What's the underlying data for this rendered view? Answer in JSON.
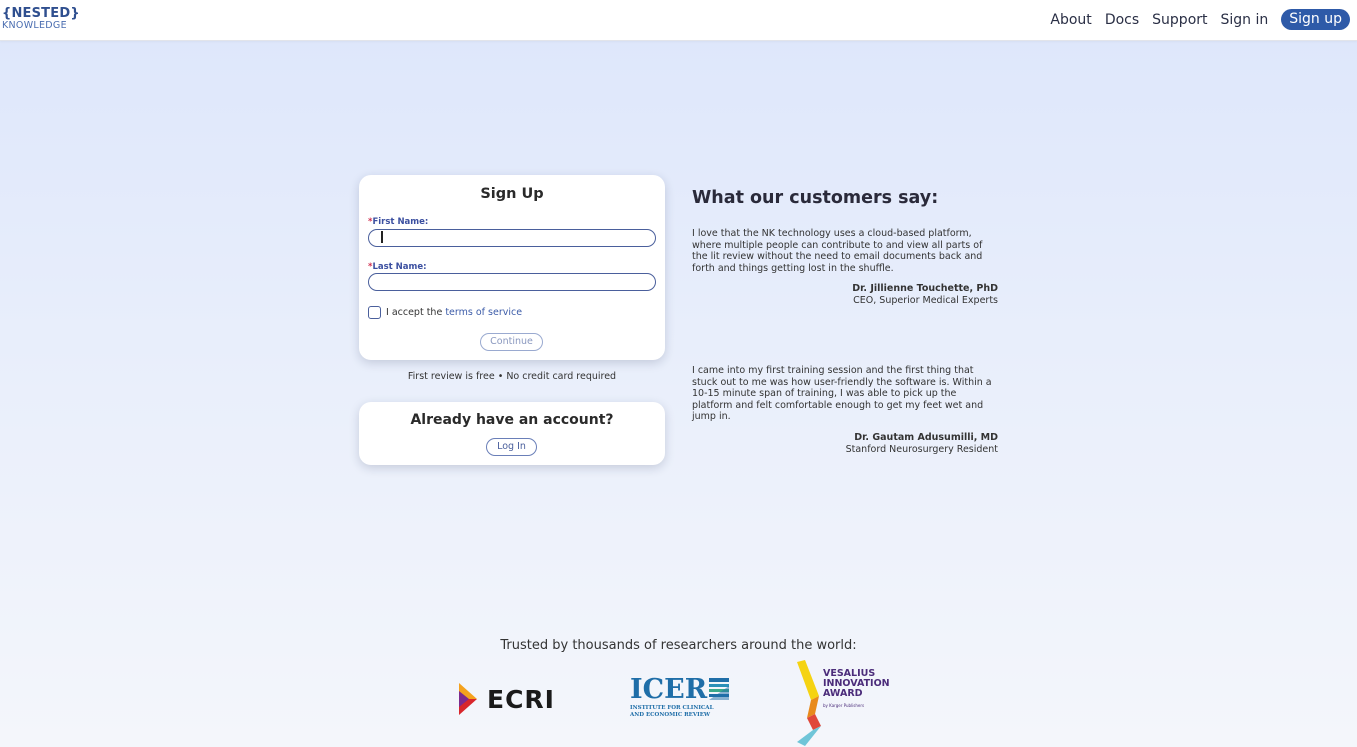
{
  "header": {
    "logo_line1": "{NESTED}",
    "logo_line2": "KNOWLEDGE",
    "nav": {
      "about": "About",
      "docs": "Docs",
      "support": "Support",
      "signin": "Sign in",
      "signup": "Sign up"
    }
  },
  "signup_card": {
    "title": "Sign Up",
    "first_name_label": "First Name:",
    "last_name_label": "Last Name:",
    "required_marker": "*",
    "first_name_value": "",
    "last_name_value": "",
    "terms_prefix": "I accept the ",
    "terms_link": "terms of service",
    "terms_checked": false,
    "continue_label": "Continue"
  },
  "free_note": "First review is free • No credit card required",
  "login_card": {
    "title": "Already have an account?",
    "login_label": "Log In"
  },
  "testimonials": {
    "heading": "What our customers say:",
    "items": [
      {
        "quote": "I love that the NK technology uses a cloud-based platform, where multiple people can contribute to and view all parts of the lit review without the need to email documents back and forth and things getting lost in the shuffle.",
        "name": "Dr. Jillienne Touchette, PhD",
        "role": "CEO, Superior Medical Experts"
      },
      {
        "quote": "I came into my first training session and the first thing that stuck out to me was how user-friendly the software is. Within a 10-15 minute span of training, I was able to pick up the platform and felt comfortable enough to get my feet wet and jump in.",
        "name": "Dr. Gautam Adusumilli, MD",
        "role": "Stanford Neurosurgery Resident"
      }
    ]
  },
  "trusted": {
    "text": "Trusted by thousands of researchers around the world:",
    "logos": {
      "ecri": "ECRI",
      "icer": "ICER",
      "icer_sub_1": "INSTITUTE FOR CLINICAL",
      "icer_sub_2": "AND ECONOMIC REVIEW",
      "vesalius_1": "VESALIUS",
      "vesalius_2": "INNOVATION",
      "vesalius_3": "AWARD",
      "vesalius_by": "by Karger Publishers"
    }
  },
  "colors": {
    "primary": "#2e5aa8",
    "field_border": "#4a5f9c",
    "required": "#d03050",
    "icer_blue": "#1f6ea8",
    "vesalius_purple": "#4b2c7a"
  }
}
